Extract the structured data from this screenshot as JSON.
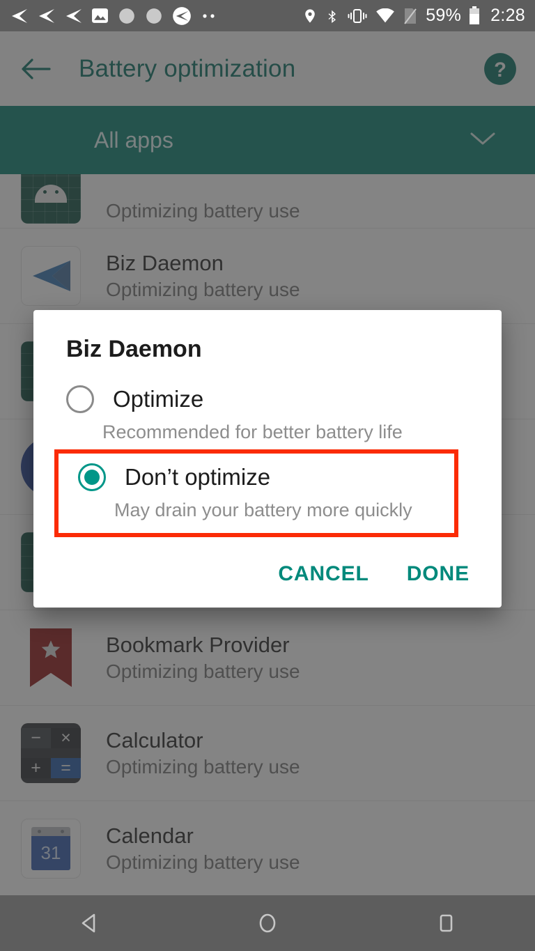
{
  "status_bar": {
    "notification_icons": [
      "app-arrow-icon",
      "app-arrow-icon",
      "app-arrow-icon",
      "image-icon",
      "sync-progress-icon",
      "sync-progress-icon",
      "app-circle-arrow-icon",
      "more-notifications-icon"
    ],
    "system_icons": [
      "location-icon",
      "bluetooth-icon",
      "vibrate-icon",
      "wifi-icon",
      "no-sim-icon"
    ],
    "battery_percent": "59%",
    "battery_icon": "battery-icon",
    "clock": "2:28"
  },
  "app_bar": {
    "back_icon": "back-arrow-icon",
    "title": "Battery optimization",
    "help_icon": "help-circle-icon"
  },
  "filter_bar": {
    "label": "All apps",
    "caret_icon": "chevron-down-icon"
  },
  "app_list": [
    {
      "name": "",
      "subtitle": "Optimizing battery use",
      "icon": "android-grid-icon",
      "clipped": true
    },
    {
      "name": "Biz Daemon",
      "subtitle": "Optimizing battery use",
      "icon": "biz-daemon-arrow-icon"
    },
    {
      "name": "",
      "subtitle": "",
      "icon": "android-grid-icon"
    },
    {
      "name": "",
      "subtitle": "",
      "icon": "blue-circle-icon"
    },
    {
      "name": "",
      "subtitle": "",
      "icon": "android-grid-icon"
    },
    {
      "name": "Bookmark Provider",
      "subtitle": "Optimizing battery use",
      "icon": "bookmark-star-icon"
    },
    {
      "name": "Calculator",
      "subtitle": "Optimizing battery use",
      "icon": "calculator-icon"
    },
    {
      "name": "Calendar",
      "subtitle": "Optimizing battery use",
      "icon": "calendar-icon"
    }
  ],
  "dialog": {
    "title": "Biz Daemon",
    "options": [
      {
        "label": "Optimize",
        "description": "Recommended for better battery life",
        "selected": false
      },
      {
        "label": "Don’t optimize",
        "description": "May drain your battery more quickly",
        "selected": true
      }
    ],
    "cancel_label": "CANCEL",
    "done_label": "DONE"
  },
  "highlight": {
    "color": "#fb2b06",
    "target": "dont-optimize-option"
  },
  "colors": {
    "accent_teal": "#009688",
    "primary_dark": "#00695c",
    "filter_bar": "#00796b",
    "system_bar": "#5d5d5d",
    "highlight_red": "#fb2b06"
  },
  "nav_bar": {
    "back_icon": "nav-back-icon",
    "home_icon": "nav-home-icon",
    "recents_icon": "nav-recents-icon"
  },
  "calculator_icon_glyphs": {
    "q1": "−",
    "q2": "×",
    "q3": "+",
    "q4": "="
  },
  "calendar_icon_day": "31"
}
